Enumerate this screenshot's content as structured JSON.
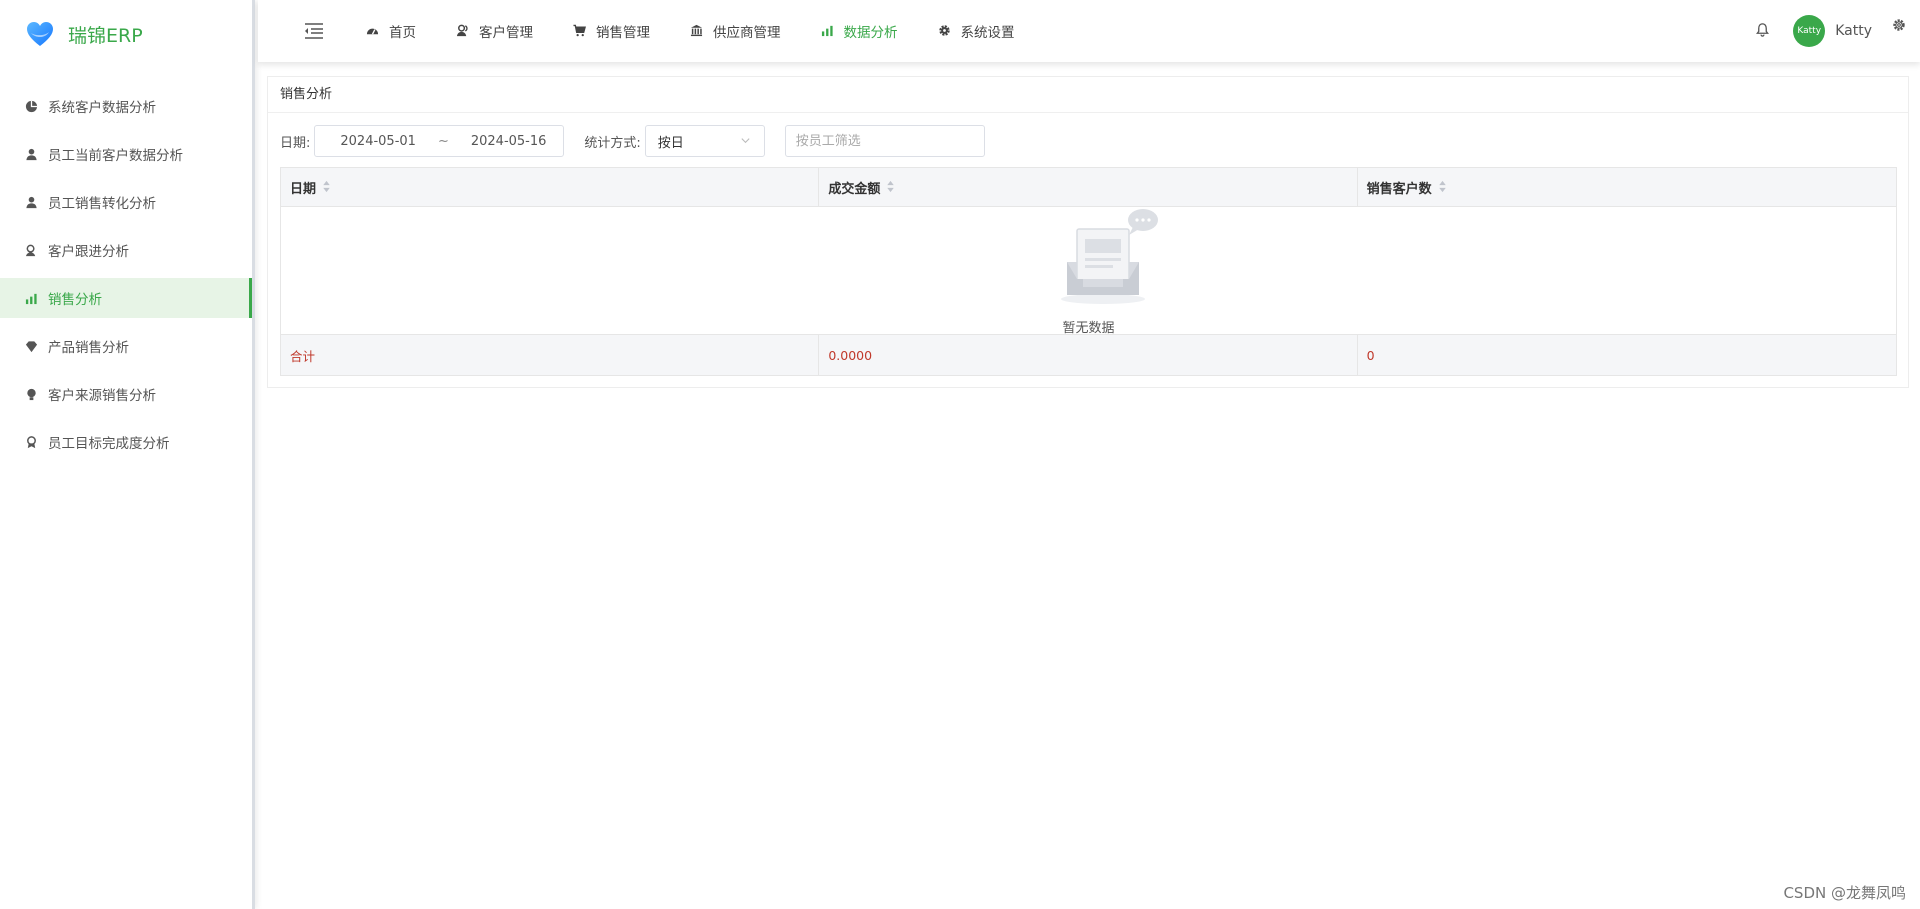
{
  "app": {
    "name": "瑞锦ERP",
    "brand_color": "#3aa84a",
    "logo_icon": "heart-logo-icon"
  },
  "sidebar": {
    "items": [
      {
        "label": "系统客户数据分析",
        "icon": "pie-chart-icon",
        "active": false
      },
      {
        "label": "员工当前客户数据分析",
        "icon": "user-icon",
        "active": false
      },
      {
        "label": "员工销售转化分析",
        "icon": "user-icon",
        "active": false
      },
      {
        "label": "客户跟进分析",
        "icon": "user-follow-icon",
        "active": false
      },
      {
        "label": "销售分析",
        "icon": "bar-chart-icon",
        "active": true
      },
      {
        "label": "产品销售分析",
        "icon": "diamond-icon",
        "active": false
      },
      {
        "label": "客户来源销售分析",
        "icon": "bulb-icon",
        "active": false
      },
      {
        "label": "员工目标完成度分析",
        "icon": "medal-icon",
        "active": false
      }
    ]
  },
  "header": {
    "nav": [
      {
        "label": "首页",
        "icon": "dashboard-icon",
        "active": false
      },
      {
        "label": "客户管理",
        "icon": "users-icon",
        "active": false
      },
      {
        "label": "销售管理",
        "icon": "cart-icon",
        "active": false
      },
      {
        "label": "供应商管理",
        "icon": "bank-icon",
        "active": false
      },
      {
        "label": "数据分析",
        "icon": "bar-chart-icon",
        "active": true
      },
      {
        "label": "系统设置",
        "icon": "gear-icon",
        "active": false
      }
    ],
    "user": {
      "avatar_text": "Katty",
      "name": "Katty"
    }
  },
  "panel": {
    "title": "销售分析",
    "filters": {
      "date_label": "日期:",
      "date_start": "2024-05-01",
      "date_sep": "~",
      "date_end": "2024-05-16",
      "stat_label": "统计方式:",
      "stat_value": "按日",
      "employee_placeholder": "按员工筛选"
    },
    "table": {
      "columns": [
        "日期",
        "成交金额",
        "销售客户数"
      ],
      "empty_text": "暂无数据",
      "summary": [
        "合计",
        "0.0000",
        "0"
      ]
    }
  },
  "watermark": "CSDN @龙舞凤鸣"
}
